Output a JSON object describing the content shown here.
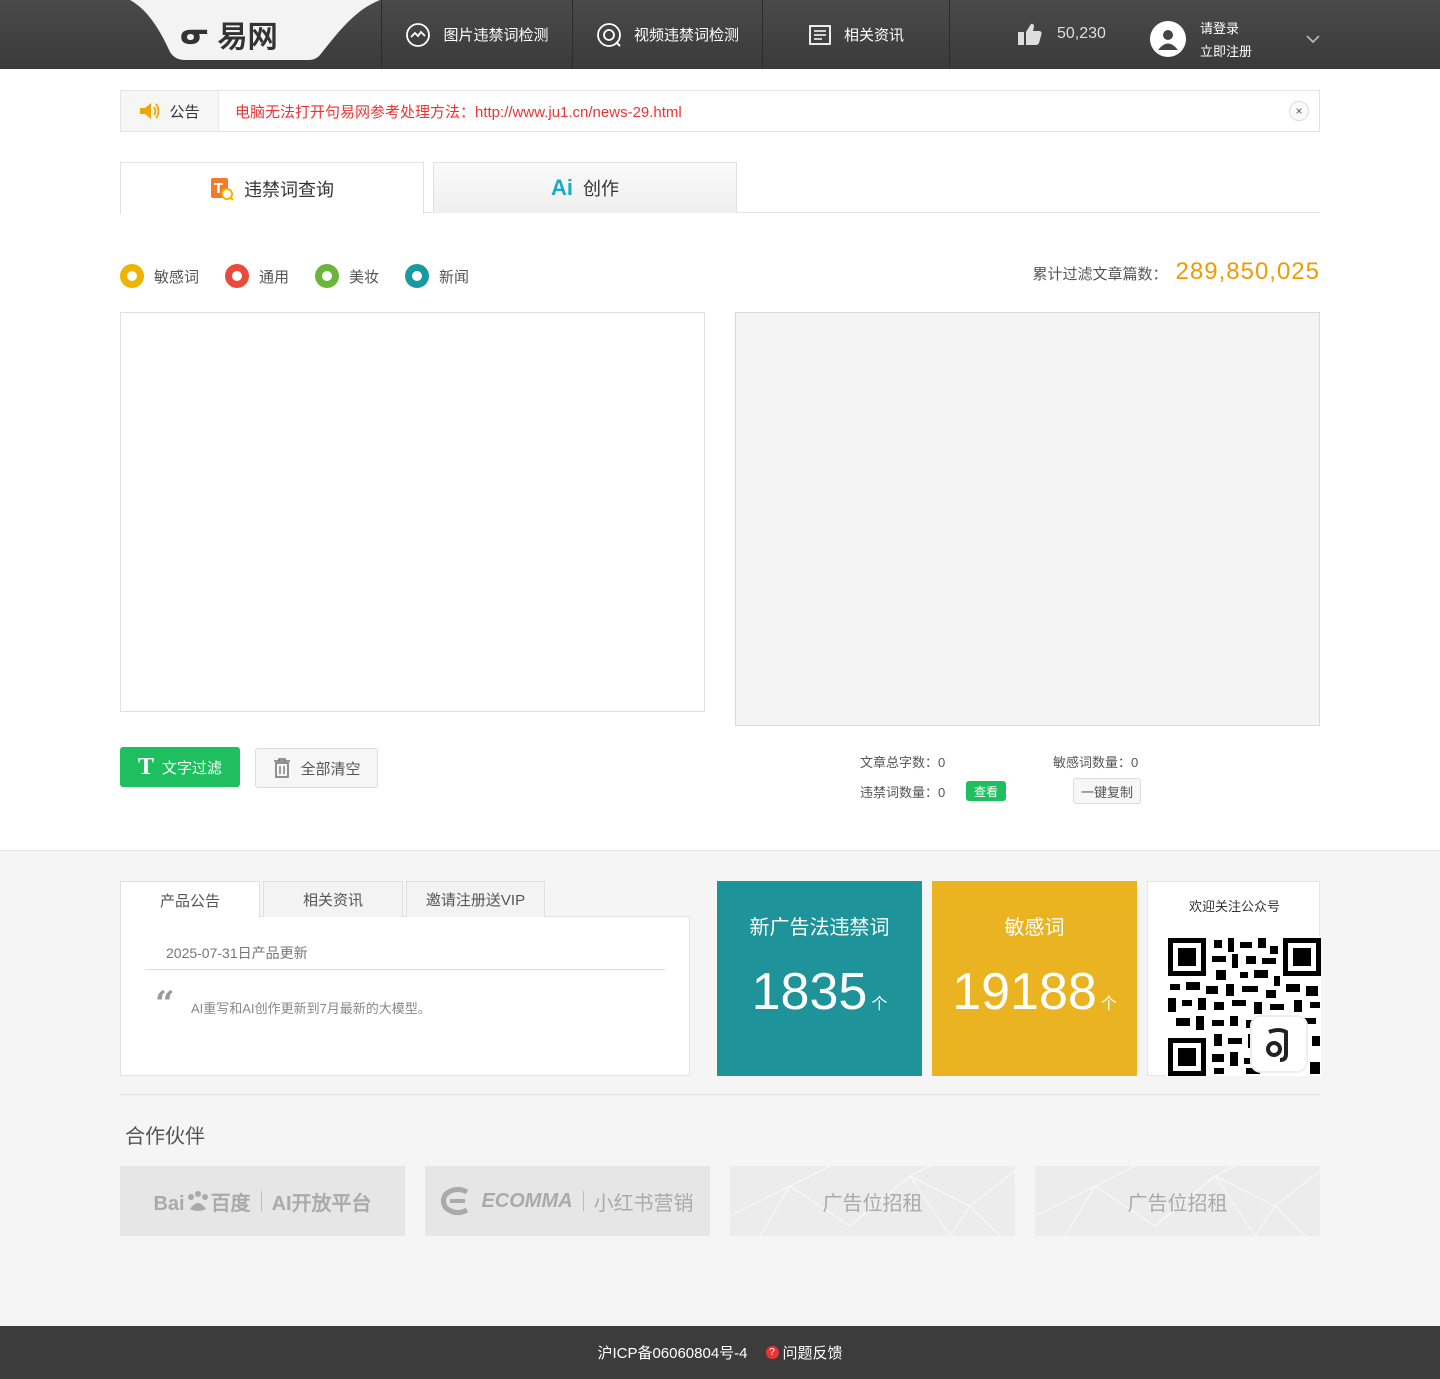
{
  "header": {
    "logo_glyph": "ᓂ",
    "logo_text": "易网",
    "nav": [
      {
        "label": "图片违禁词检测",
        "icon": "image-scan-icon"
      },
      {
        "label": "视频违禁词检测",
        "icon": "video-scan-icon"
      },
      {
        "label": "相关资讯",
        "icon": "news-icon"
      }
    ],
    "likes": "50,230",
    "login": "请登录",
    "register": "立即注册"
  },
  "notice": {
    "label": "公告",
    "text": "电脑无法打开句易网参考处理方法：http://www.ju1.cn/news-29.html",
    "close": "×"
  },
  "tabs": [
    {
      "label": "违禁词查询"
    },
    {
      "icon_text": "Ai",
      "label": "创作"
    }
  ],
  "categories": [
    {
      "label": "敏感词",
      "color": "#f0b400"
    },
    {
      "label": "通用",
      "color": "#e94a3c"
    },
    {
      "label": "美妆",
      "color": "#6ab63c"
    },
    {
      "label": "新闻",
      "color": "#1a9aa0"
    }
  ],
  "filter_count": {
    "label": "累计过滤文章篇数：",
    "value": "289,850,025"
  },
  "actions": {
    "filter": "文字过滤",
    "filter_icon": "T",
    "clear": "全部清空"
  },
  "stats": {
    "total_chars_label": "文章总字数：",
    "total_chars": "0",
    "sensitive_label": "敏感词数量：",
    "sensitive": "0",
    "banned_label": "违禁词数量：",
    "banned": "0",
    "view": "查看",
    "copy": "一键复制"
  },
  "news": {
    "tabs": [
      "产品公告",
      "相关资讯",
      "邀请注册送VIP"
    ],
    "date": "2025-07-31日产品更新",
    "quote": "“",
    "text": "AI重写和AI创作更新到7月最新的大模型。"
  },
  "cards": [
    {
      "title": "新广告法违禁词",
      "value": "1835",
      "unit": "个",
      "color": "#1e9399"
    },
    {
      "title": "敏感词",
      "value": "19188",
      "unit": "个",
      "color": "#e9b322"
    }
  ],
  "qr": {
    "title": "欢迎关注公众号"
  },
  "partners": {
    "title": "合作伙伴",
    "items": [
      {
        "name": "Bai",
        "name2": "百度",
        "sub": "AI开放平台"
      },
      {
        "name": "ECOMMA",
        "sub": "小红书营销"
      },
      {
        "sub": "广告位招租"
      },
      {
        "sub": "广告位招租"
      }
    ]
  },
  "footer": {
    "icp": "沪ICP备06060804号-4",
    "feedback": "问题反馈",
    "feedback_icon": "?"
  }
}
